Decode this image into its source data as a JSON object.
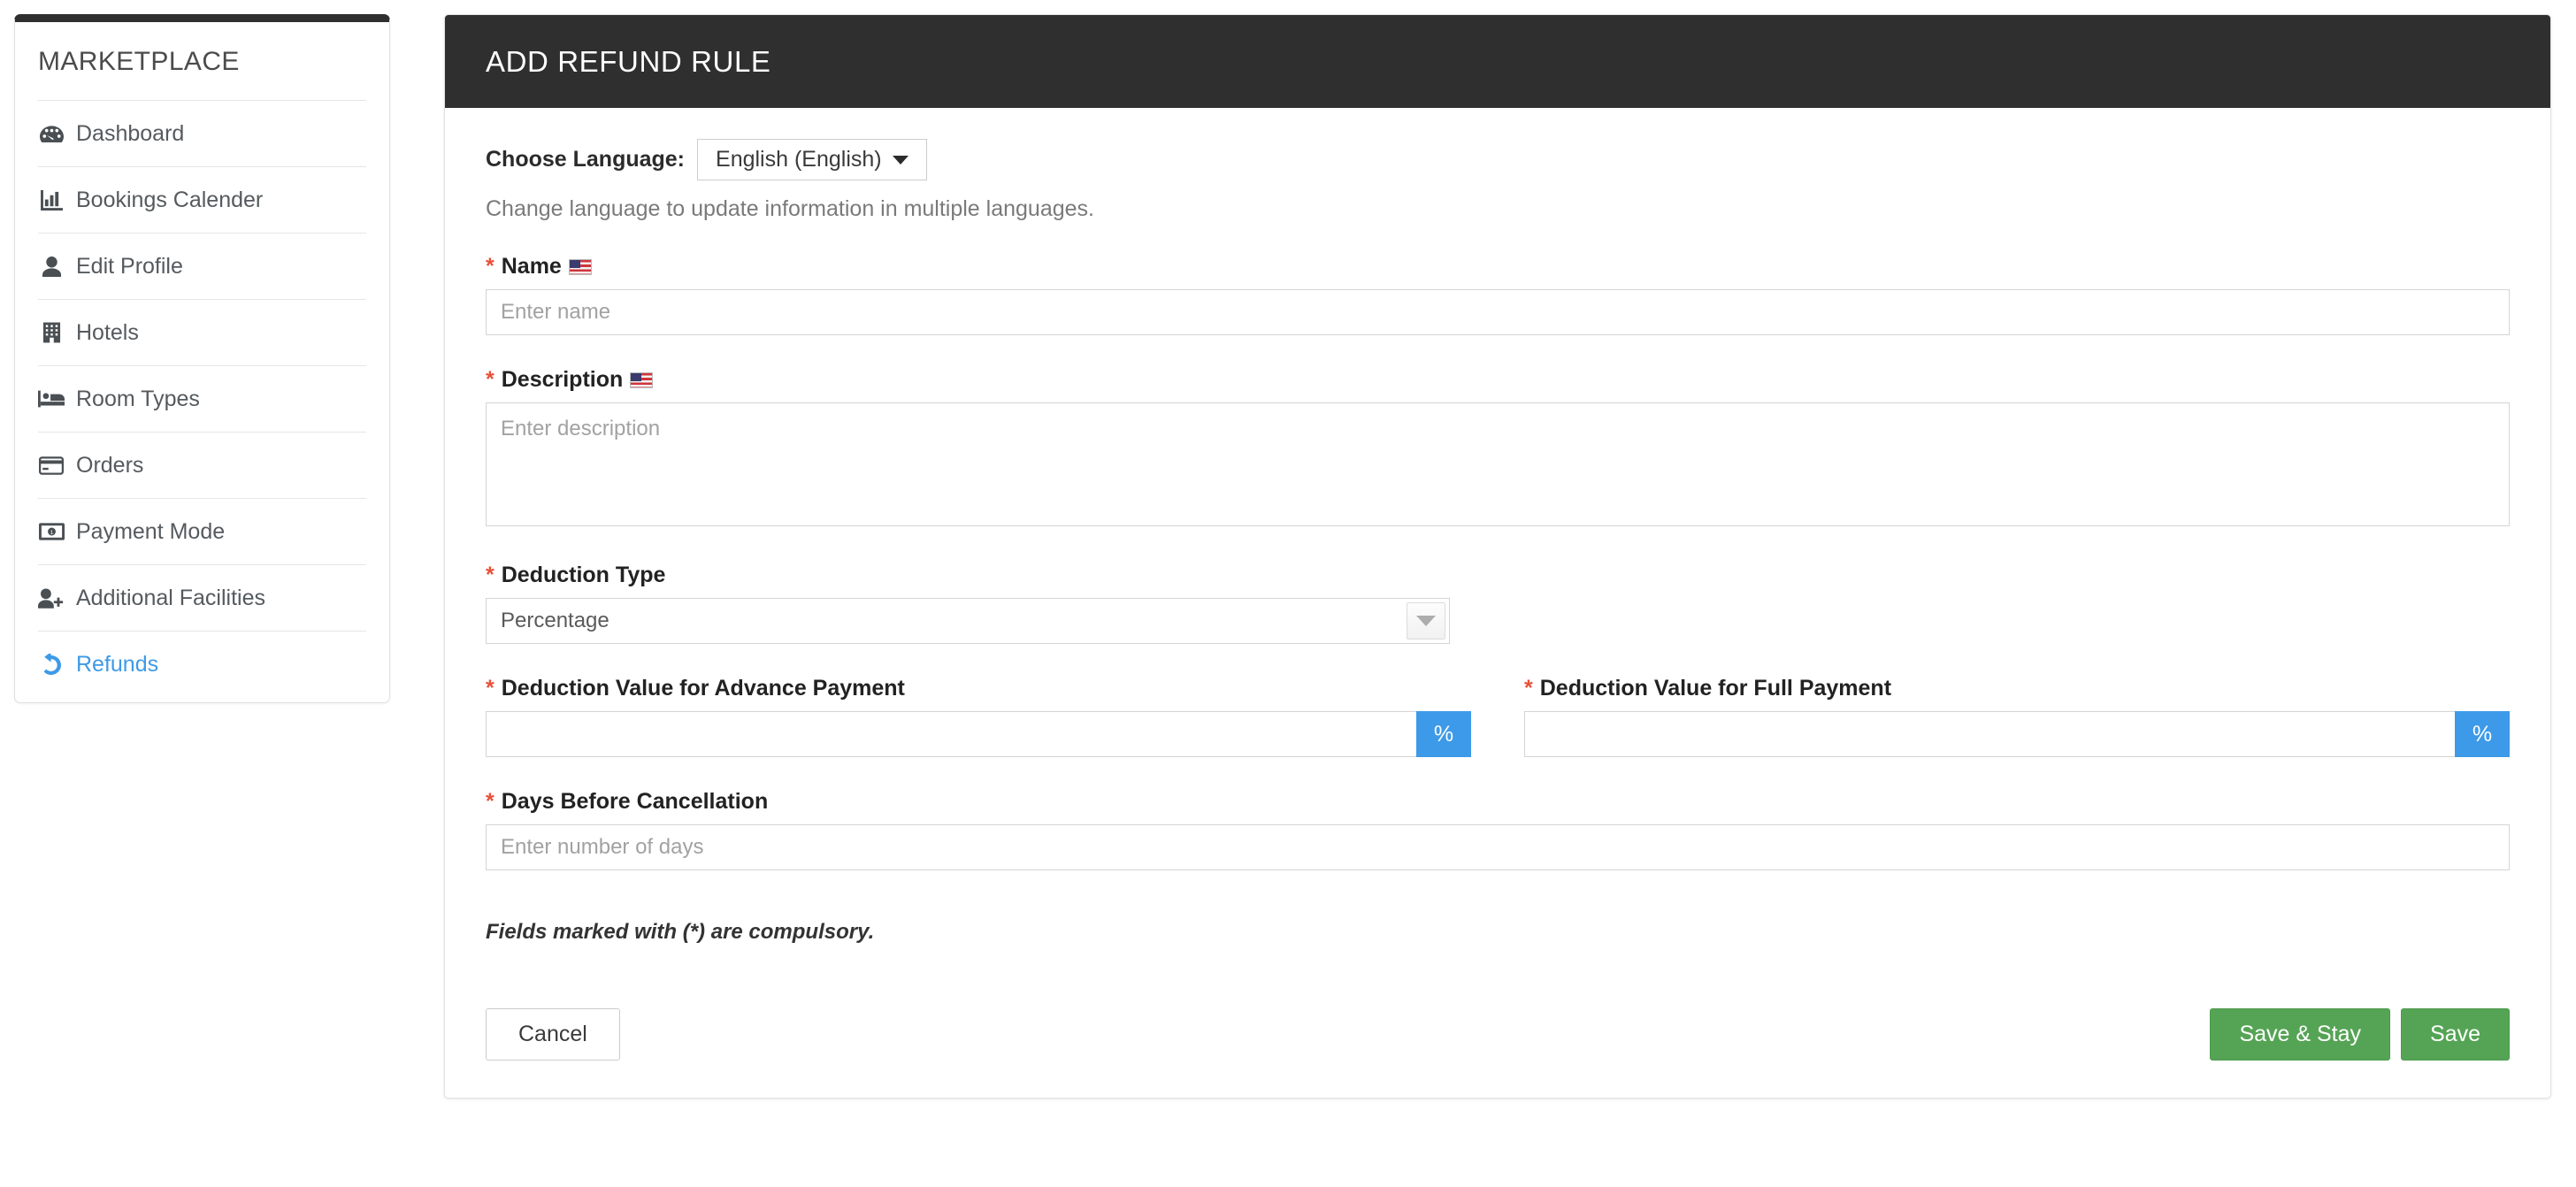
{
  "sidebar": {
    "title": "MARKETPLACE",
    "items": [
      {
        "label": "Dashboard",
        "icon": "dashboard-icon",
        "active": false
      },
      {
        "label": "Bookings Calender",
        "icon": "bar-chart-icon",
        "active": false
      },
      {
        "label": "Edit Profile",
        "icon": "user-icon",
        "active": false
      },
      {
        "label": "Hotels",
        "icon": "building-icon",
        "active": false
      },
      {
        "label": "Room Types",
        "icon": "bed-icon",
        "active": false
      },
      {
        "label": "Orders",
        "icon": "credit-card-icon",
        "active": false
      },
      {
        "label": "Payment Mode",
        "icon": "money-bill-icon",
        "active": false
      },
      {
        "label": "Additional Facilities",
        "icon": "user-plus-icon",
        "active": false
      },
      {
        "label": "Refunds",
        "icon": "undo-icon",
        "active": true
      }
    ]
  },
  "header": {
    "title": "ADD REFUND RULE"
  },
  "language": {
    "label": "Choose Language:",
    "selected": "English (English)",
    "hint": "Change language to update information in multiple languages."
  },
  "form": {
    "name": {
      "required_mark": "*",
      "label": "Name",
      "flag": "us-flag-icon",
      "placeholder": "Enter name",
      "value": ""
    },
    "description": {
      "required_mark": "*",
      "label": "Description",
      "flag": "us-flag-icon",
      "placeholder": "Enter description",
      "value": ""
    },
    "deduction_type": {
      "required_mark": "*",
      "label": "Deduction Type",
      "selected": "Percentage"
    },
    "advance_payment": {
      "required_mark": "*",
      "label": "Deduction Value for Advance Payment",
      "placeholder": "",
      "value": "",
      "addon": "%"
    },
    "full_payment": {
      "required_mark": "*",
      "label": "Deduction Value for Full Payment",
      "placeholder": "",
      "value": "",
      "addon": "%"
    },
    "days_before_cancellation": {
      "required_mark": "*",
      "label": "Days Before Cancellation",
      "placeholder": "Enter number of days",
      "value": ""
    },
    "note": "Fields marked with (*) are compulsory."
  },
  "actions": {
    "cancel": "Cancel",
    "save_and_stay": "Save & Stay",
    "save": "Save"
  },
  "colors": {
    "header_dark": "#2f2f2f",
    "accent_blue": "#3d9ae8",
    "save_green": "#55a455",
    "required_red": "#e8503a"
  }
}
